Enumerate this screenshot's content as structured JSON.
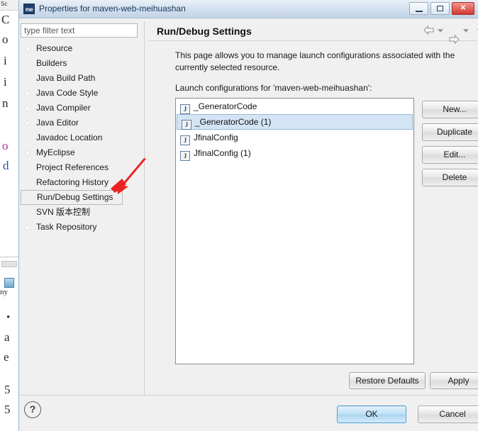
{
  "window": {
    "title": "Properties for maven-web-meihuashan",
    "app_icon": "me",
    "minimize_label": "Minimize",
    "maximize_label": "Maximize",
    "close_label": "Close",
    "close_glyph": "✕"
  },
  "filter": {
    "value": "",
    "placeholder": "type filter text"
  },
  "sidebar": {
    "items": [
      {
        "label": "Resource",
        "expandable": true,
        "selected": false
      },
      {
        "label": "Builders",
        "expandable": false,
        "selected": false
      },
      {
        "label": "Java Build Path",
        "expandable": false,
        "selected": false
      },
      {
        "label": "Java Code Style",
        "expandable": true,
        "selected": false
      },
      {
        "label": "Java Compiler",
        "expandable": true,
        "selected": false
      },
      {
        "label": "Java Editor",
        "expandable": true,
        "selected": false
      },
      {
        "label": "Javadoc Location",
        "expandable": false,
        "selected": false
      },
      {
        "label": "MyEclipse",
        "expandable": true,
        "selected": false
      },
      {
        "label": "Project References",
        "expandable": false,
        "selected": false
      },
      {
        "label": "Refactoring History",
        "expandable": false,
        "selected": false
      },
      {
        "label": "Run/Debug Settings",
        "expandable": false,
        "selected": true
      },
      {
        "label": "SVN 版本控制",
        "expandable": false,
        "selected": false
      },
      {
        "label": "Task Repository",
        "expandable": true,
        "selected": false
      }
    ]
  },
  "page": {
    "title": "Run/Debug Settings",
    "description": "This page allows you to manage launch configurations associated with the currently selected resource.",
    "list_label": "Launch configurations for 'maven-web-meihuashan':"
  },
  "nav": {
    "back_icon": "back-arrow-icon",
    "back_menu_icon": "chevron-down-icon",
    "forward_icon": "forward-arrow-icon",
    "forward_menu_icon": "chevron-down-icon",
    "view_menu_icon": "chevron-down-icon"
  },
  "launch_configs": [
    {
      "name": "_GeneratorCode",
      "icon": "java-launch-icon",
      "icon_glyph": "J",
      "selected": false
    },
    {
      "name": "_GeneratorCode (1)",
      "icon": "java-launch-icon",
      "icon_glyph": "J",
      "selected": true
    },
    {
      "name": "JfinalConfig",
      "icon": "java-launch-icon",
      "icon_glyph": "J",
      "selected": false
    },
    {
      "name": "JfinalConfig (1)",
      "icon": "java-launch-icon",
      "icon_glyph": "J",
      "selected": false
    }
  ],
  "side_buttons": {
    "new": "New...",
    "duplicate": "Duplicate",
    "edit": "Edit...",
    "delete": "Delete"
  },
  "footer": {
    "restore_defaults": "Restore Defaults",
    "apply": "Apply",
    "ok": "OK",
    "cancel": "Cancel",
    "help_glyph": "?"
  },
  "annotation": {
    "arrow_color": "#ee2222",
    "points_to": "Run/Debug Settings"
  },
  "background_editor": {
    "tab_label": "Sc",
    "glyphs": [
      "C",
      "o",
      "i",
      "i",
      "n",
      "o",
      "d",
      "ny",
      "•",
      "a",
      "e",
      "5",
      "5"
    ]
  },
  "colors": {
    "title_bar": "#cfdded",
    "selection": "#d3e5f5",
    "ok_accent": "#a9d4f0",
    "close_button": "#cf3b30"
  }
}
